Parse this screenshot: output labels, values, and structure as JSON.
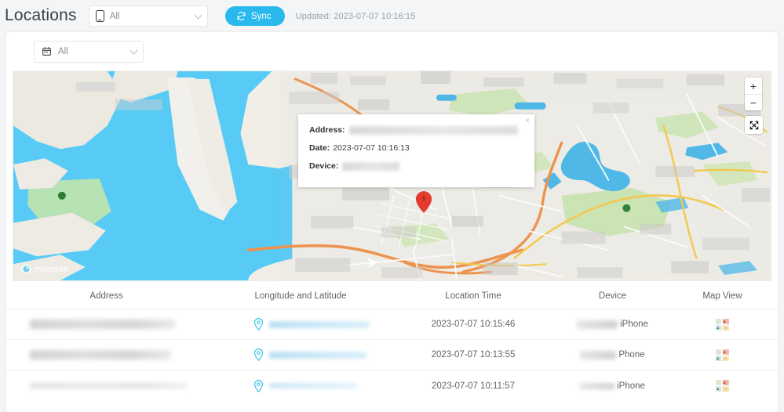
{
  "header": {
    "title": "Locations",
    "device_filter": {
      "value": "All",
      "icon": "phone-icon"
    },
    "sync_button": {
      "label": "Sync",
      "icon": "refresh-icon",
      "color": "#29b9ec"
    },
    "updated_text": "Updated: 2023-07-07 10:16:15"
  },
  "filters": {
    "date_filter": {
      "value": "All",
      "icon": "calendar-icon"
    }
  },
  "map": {
    "attribution": "mapbox",
    "zoom_in_label": "+",
    "zoom_out_label": "−",
    "fullscreen_label": "fullscreen",
    "popup": {
      "close_label": "×",
      "address_label": "Address:",
      "address_value": "",
      "date_label": "Date:",
      "date_value": "2023-07-07 10:16:13",
      "device_label": "Device:",
      "device_value": ""
    },
    "marker": {
      "name": "location-marker",
      "color": "#e33b2e"
    }
  },
  "table": {
    "columns": [
      "Address",
      "Longitude and Latitude",
      "Location Time",
      "Device",
      "Map View"
    ],
    "rows": [
      {
        "address": "",
        "coordinates": "",
        "time": "2023-07-07 10:15:46",
        "device": "iPhone",
        "map_view": "map-thumbnail-icon"
      },
      {
        "address": "",
        "coordinates": "",
        "time": "2023-07-07 10:13:55",
        "device": "Phone",
        "map_view": "map-thumbnail-icon"
      },
      {
        "address": "",
        "coordinates": "",
        "time": "2023-07-07 10:11:57",
        "device": "iPhone",
        "map_view": "map-thumbnail-icon"
      }
    ]
  },
  "colors": {
    "accent": "#29b9ec",
    "water": "#57cbf5",
    "land": "#f1efe8",
    "marker_red": "#e33b2e",
    "pin_cyan": "#3fc0ea"
  }
}
